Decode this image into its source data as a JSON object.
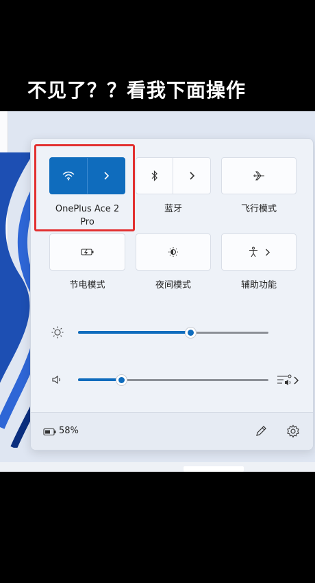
{
  "caption": "不见了？？看我下面操作",
  "quick_settings": {
    "tiles": [
      {
        "label": "OnePlus Ace 2 Pro",
        "icon": "wifi-icon",
        "active": true
      },
      {
        "label": "蓝牙",
        "icon": "bluetooth-icon",
        "active": false
      },
      {
        "label": "飞行模式",
        "icon": "airplane-icon",
        "active": false
      },
      {
        "label": "节电模式",
        "icon": "battery-saver-icon",
        "active": false
      },
      {
        "label": "夜间模式",
        "icon": "night-light-icon",
        "active": false
      },
      {
        "label": "辅助功能",
        "icon": "accessibility-icon",
        "active": false
      }
    ],
    "brightness": {
      "icon": "brightness-icon",
      "level": 0.59
    },
    "volume": {
      "icon": "speaker-icon",
      "level": 0.23,
      "output_icon": "audio-output-icon"
    },
    "battery": {
      "icon": "battery-icon",
      "percent_text": "58%"
    },
    "edit_icon": "pencil-icon",
    "settings_icon": "gear-icon"
  },
  "colors": {
    "accent": "#0f6cbd",
    "highlight": "#e23030"
  }
}
